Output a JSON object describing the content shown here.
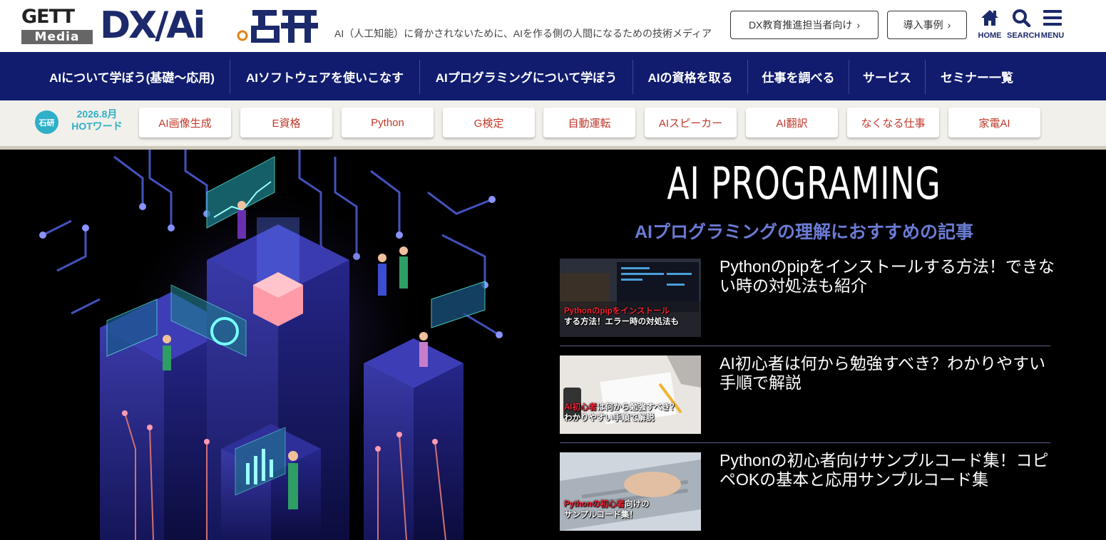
{
  "header": {
    "logo": {
      "gett": "GETT",
      "media": "Media",
      "dx": "DX/Ai"
    },
    "tagline": "AI（人工知能）に脅かされないために、AIを作る側の人間になるための技術メディア",
    "buttons": [
      {
        "label": "DX教育推進担当者向け"
      },
      {
        "label": "導入事例"
      }
    ],
    "icons": [
      {
        "icon": "home-icon",
        "label": "HOME"
      },
      {
        "icon": "search-icon",
        "label": "SEARCH"
      },
      {
        "icon": "menu-icon",
        "label": "MENU"
      }
    ]
  },
  "nav": {
    "items": [
      {
        "label": "AIについて学ぼう(基礎〜応用)"
      },
      {
        "label": "AIソフトウェアを使いこなす"
      },
      {
        "label": "AIプログラミングについて学ぼう"
      },
      {
        "label": "AIの資格を取る"
      },
      {
        "label": "仕事を調べる"
      },
      {
        "label": "サービス"
      },
      {
        "label": "セミナー一覧"
      }
    ]
  },
  "hot": {
    "badge": "石研",
    "date": "2026.8月",
    "label": "HOTワード",
    "words": [
      "AI画像生成",
      "E資格",
      "Python",
      "G検定",
      "自動運転",
      "AIスピーカー",
      "AI翻訳",
      "なくなる仕事",
      "家電AI"
    ]
  },
  "hero": {
    "title": "AI PROGRAMING",
    "subtitle": "AIプログラミングの理解におすすめの記事",
    "articles": [
      {
        "title": "Pythonのpipをインストールする方法！できない時の対処法も紹介",
        "thumb_line1_red": "Pythonのpipをインストール",
        "thumb_line2": "する方法！エラー時の対処法も"
      },
      {
        "title": "AI初心者は何から勉強すべき？わかりやすい手順で解説",
        "thumb_line1_red": "AI初心者",
        "thumb_line1_rest": "は何から勉強すべき？",
        "thumb_line2": "わかりやすい手順で解説"
      },
      {
        "title": "Pythonの初心者向けサンプルコード集！コピペOKの基本と応用サンプルコード集",
        "thumb_line1_red": "Pythonの初心者",
        "thumb_line1_rest": "向けの",
        "thumb_line2": "サンプルコード集！"
      }
    ]
  },
  "colors": {
    "nav_bg": "#111c6e",
    "accent": "#2db0c8",
    "chip_text": "#c0392b",
    "subtitle": "#6b7bd4"
  }
}
